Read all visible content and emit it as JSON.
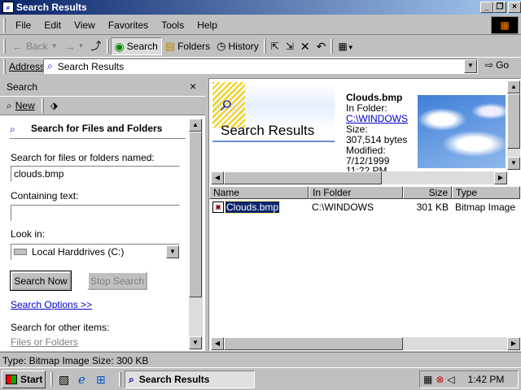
{
  "window": {
    "title": "Search Results"
  },
  "menu": [
    "File",
    "Edit",
    "View",
    "Favorites",
    "Tools",
    "Help"
  ],
  "toolbar": {
    "back": "Back",
    "search": "Search",
    "folders": "Folders",
    "history": "History"
  },
  "address": {
    "label": "Address",
    "value": "Search Results",
    "go": "Go"
  },
  "search_pane": {
    "header": "Search",
    "new_label": "New",
    "heading": "Search for Files and Folders",
    "named_label": "Search for files or folders named:",
    "named_value": "clouds.bmp",
    "containing_label": "Containing text:",
    "containing_value": "",
    "lookin_label": "Look in:",
    "lookin_value": "Local Harddrives (C:)",
    "search_now": "Search Now",
    "stop_search": "Stop Search",
    "options_link": "Search Options >>",
    "other_label": "Search for other items:",
    "other_link": "Files or Folders"
  },
  "preview": {
    "title": "Search Results",
    "filename": "Clouds.bmp",
    "in_folder_label": "In Folder:",
    "folder_link": "C:\\WINDOWS",
    "size_label": "Size:",
    "size_value": "307,514 bytes",
    "modified_label": "Modified:",
    "modified_date": "7/12/1999",
    "modified_time": "11:22 PM"
  },
  "list": {
    "columns": [
      "Name",
      "In Folder",
      "Size",
      "Type"
    ],
    "rows": [
      {
        "name": "Clouds.bmp",
        "folder": "C:\\WINDOWS",
        "size": "301 KB",
        "type": "Bitmap Image"
      }
    ]
  },
  "status": {
    "text": "Type: Bitmap Image Size: 300 KB"
  },
  "taskbar": {
    "start": "Start",
    "task": "Search Results",
    "clock": "1:42 PM"
  },
  "colors": {
    "titlebar": "#0a246a",
    "selection": "#0a246a",
    "face": "#c0c0c0"
  }
}
